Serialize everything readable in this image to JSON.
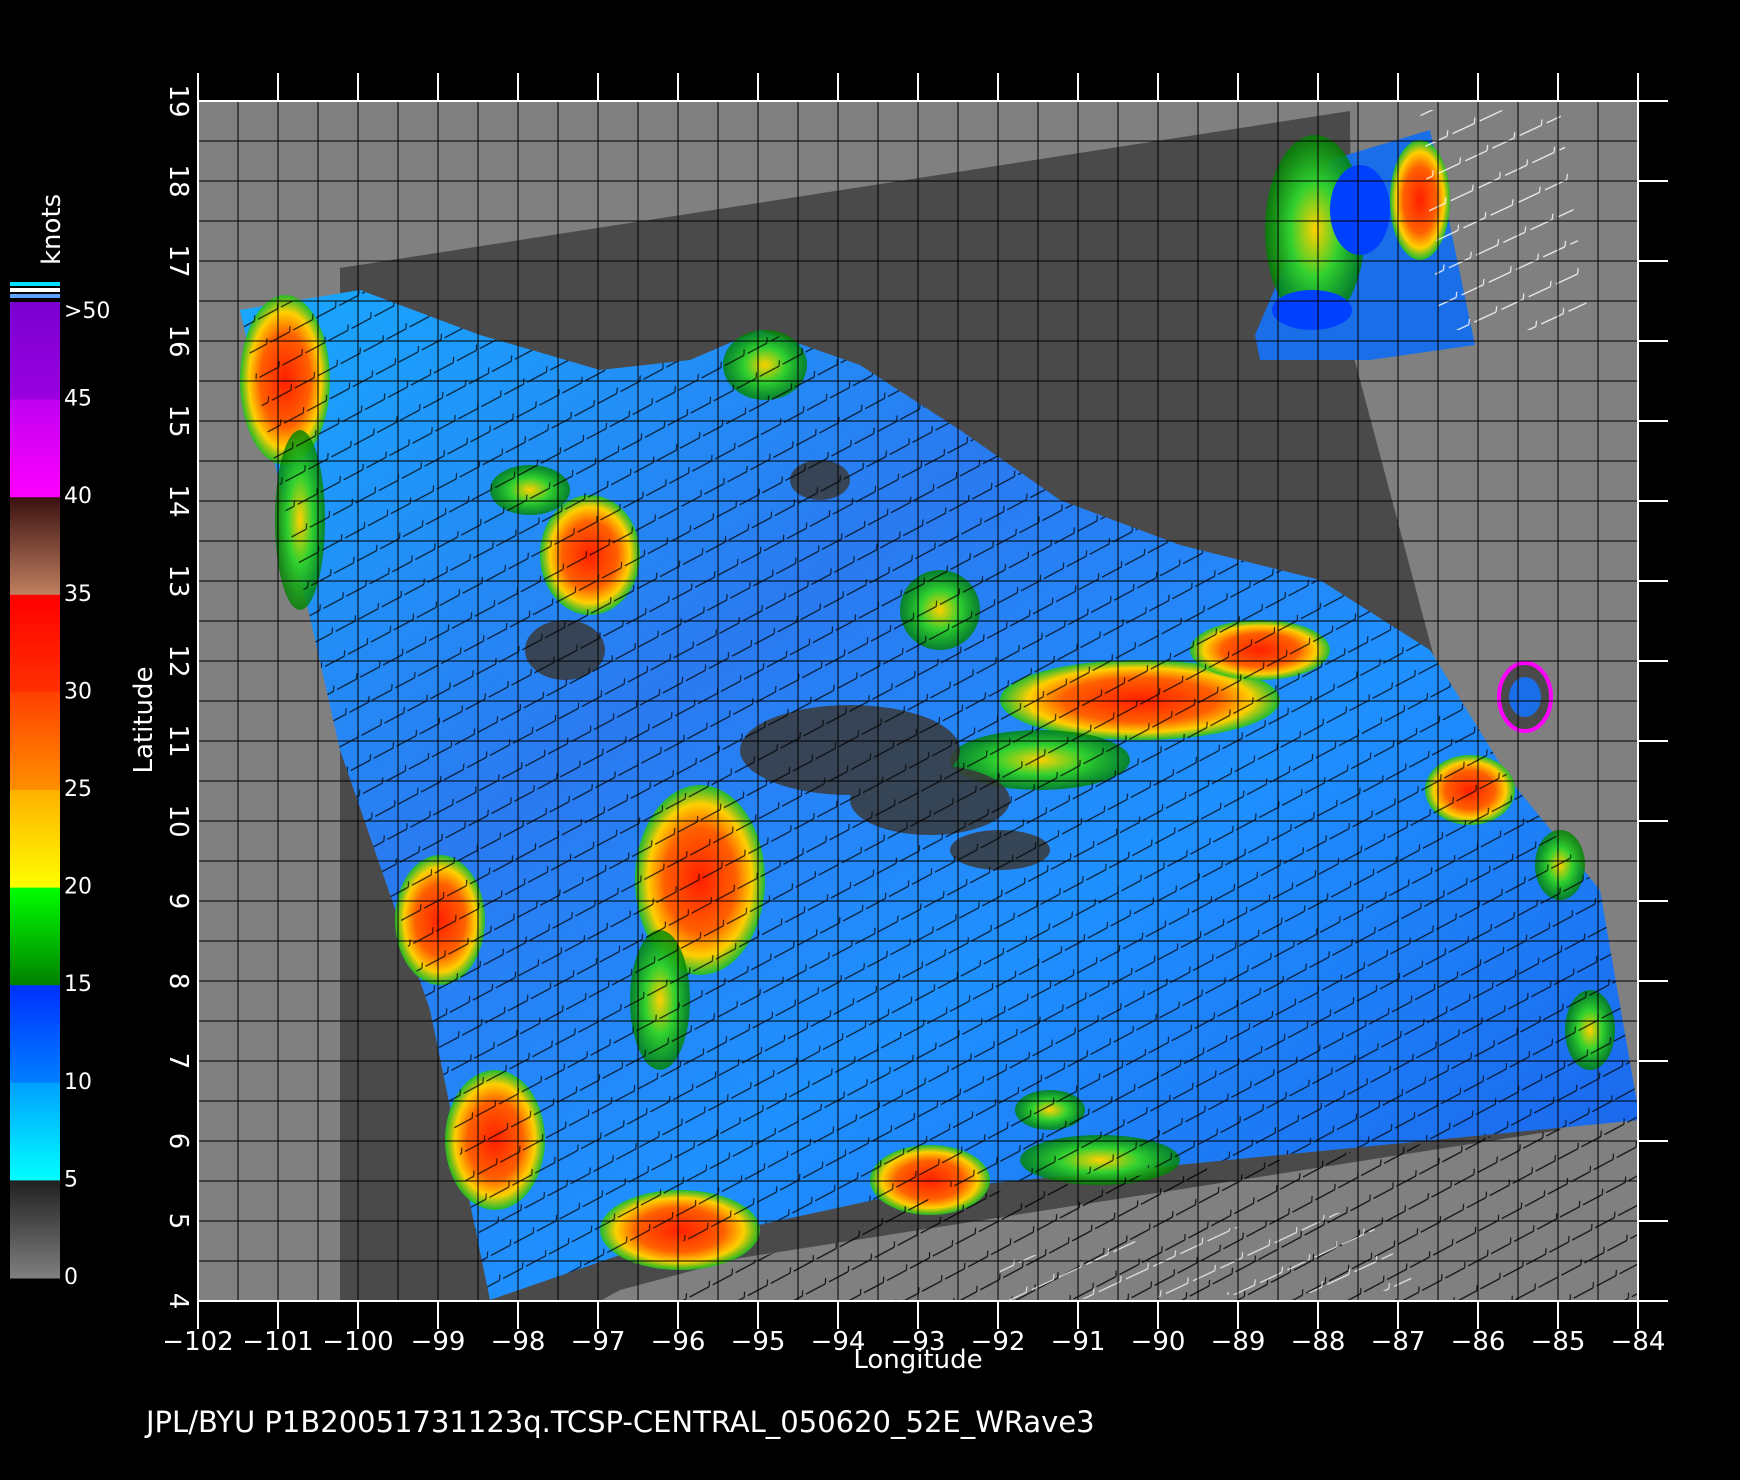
{
  "colorbar": {
    "unit": "knots",
    "labels": [
      ">50",
      "45",
      "40",
      "35",
      "30",
      "25",
      "20",
      "15",
      "10",
      "5",
      "0"
    ],
    "bands": [
      {
        "from": 50,
        "to": 45,
        "top": "#7a00d0",
        "bottom": "#9a00e0"
      },
      {
        "from": 45,
        "to": 40,
        "top": "#c000f0",
        "bottom": "#ff00ff"
      },
      {
        "from": 40,
        "to": 35,
        "top": "#3a1010",
        "bottom": "#c08060"
      },
      {
        "from": 35,
        "to": 30,
        "top": "#ff0000",
        "bottom": "#ff3000"
      },
      {
        "from": 30,
        "to": 25,
        "top": "#ff4000",
        "bottom": "#ff9000"
      },
      {
        "from": 25,
        "to": 20,
        "top": "#ffb000",
        "bottom": "#ffff00"
      },
      {
        "from": 20,
        "to": 15,
        "top": "#00ff00",
        "bottom": "#008000"
      },
      {
        "from": 15,
        "to": 10,
        "top": "#0030ff",
        "bottom": "#0080ff"
      },
      {
        "from": 10,
        "to": 5,
        "top": "#00a0ff",
        "bottom": "#00ffff"
      },
      {
        "from": 5,
        "to": 0,
        "top": "#202020",
        "bottom": "#808080"
      }
    ]
  },
  "axes": {
    "xlabel": "Longitude",
    "ylabel": "Latitude",
    "xlim": [
      -102,
      -84
    ],
    "ylim": [
      4,
      19
    ],
    "xticks": [
      "−102",
      "−101",
      "−100",
      "−99",
      "−98",
      "−97",
      "−96",
      "−95",
      "−94",
      "−93",
      "−92",
      "−91",
      "−90",
      "−89",
      "−88",
      "−87",
      "−86",
      "−85",
      "−84"
    ],
    "yticks": [
      "4",
      "5",
      "6",
      "7",
      "8",
      "9",
      "10",
      "11",
      "12",
      "13",
      "14",
      "15",
      "16",
      "17",
      "18",
      "19"
    ]
  },
  "footer": "JPL/BYU  P1B20051731123q.TCSP-CENTRAL_050620_52E_WRave3",
  "colors": {
    "background": "#000000",
    "land_mask": "#808080",
    "no_data_swath": "#4a4a4a",
    "grid": "#000000",
    "ocean_low": "#1a60f0",
    "ocean_mid": "#20b0ff"
  }
}
